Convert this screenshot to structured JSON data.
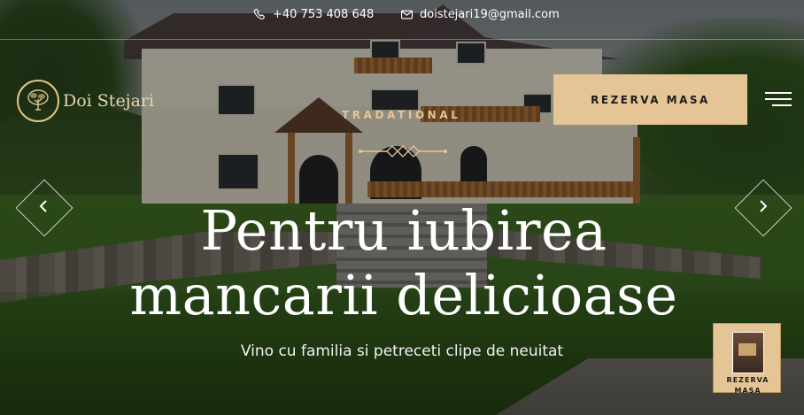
{
  "topbar": {
    "phone": "+40 753 408 648",
    "email": "doistejari19@gmail.com",
    "phone_icon": "phone-icon",
    "email_icon": "envelope-icon"
  },
  "brand": {
    "name": "Doi Stejari",
    "emblem_icon": "oak-tree-icon"
  },
  "header": {
    "reserve_label": "REZERVA MASA",
    "menu_icon": "hamburger-menu-icon"
  },
  "hero": {
    "kicker": "TRADATIONAL",
    "headline_line1": "Pentru iubirea",
    "headline_line2": "mancarii delicioase",
    "subline": "Vino cu familia si petreceti clipe de neuitat"
  },
  "slider": {
    "prev_icon": "chevron-left-icon",
    "next_icon": "chevron-right-icon"
  },
  "floating_widget": {
    "label_line1": "REZERVA",
    "label_line2": "MASA"
  },
  "colors": {
    "accent": "#e5c596",
    "brand_gold": "#e8d7a8"
  }
}
